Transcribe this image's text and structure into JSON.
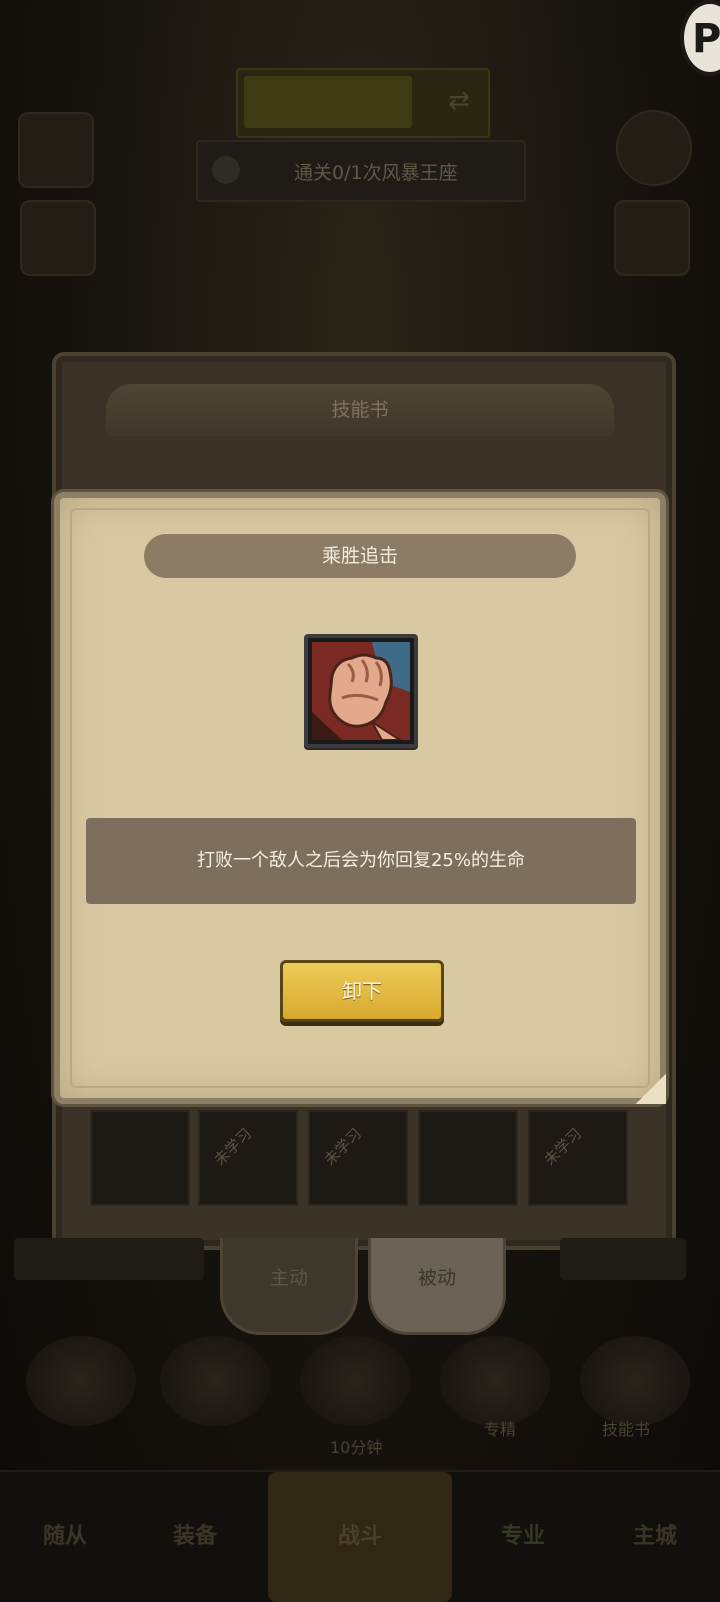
{
  "background": {
    "top_banner_text": "",
    "quest_text": "通关0/1次风暴王座",
    "skill_book_panel_title": "技能书",
    "skill_slots": [
      {
        "tag": ""
      },
      {
        "tag": "未学习"
      },
      {
        "tag": "未学习"
      },
      {
        "tag": ""
      },
      {
        "tag": "未学习"
      }
    ],
    "tabs": {
      "active": "主动",
      "passive": "被动"
    },
    "bottom_labels": {
      "timer": "10分钟",
      "specialty": "专精",
      "skill_book": "技能书"
    },
    "nav": [
      "随从",
      "装备",
      "战斗",
      "专业",
      "主城"
    ]
  },
  "modal": {
    "title": "乘胜追击",
    "icon": "fist-icon",
    "description": "打败一个敌人之后会为你回复25%的生命",
    "unequip_label": "卸下"
  },
  "colors": {
    "modal_bg": "#d8c9a3",
    "ribbon": "#8c7c66",
    "desc_box": "#7d6e5e",
    "button": "#e4bb46"
  }
}
